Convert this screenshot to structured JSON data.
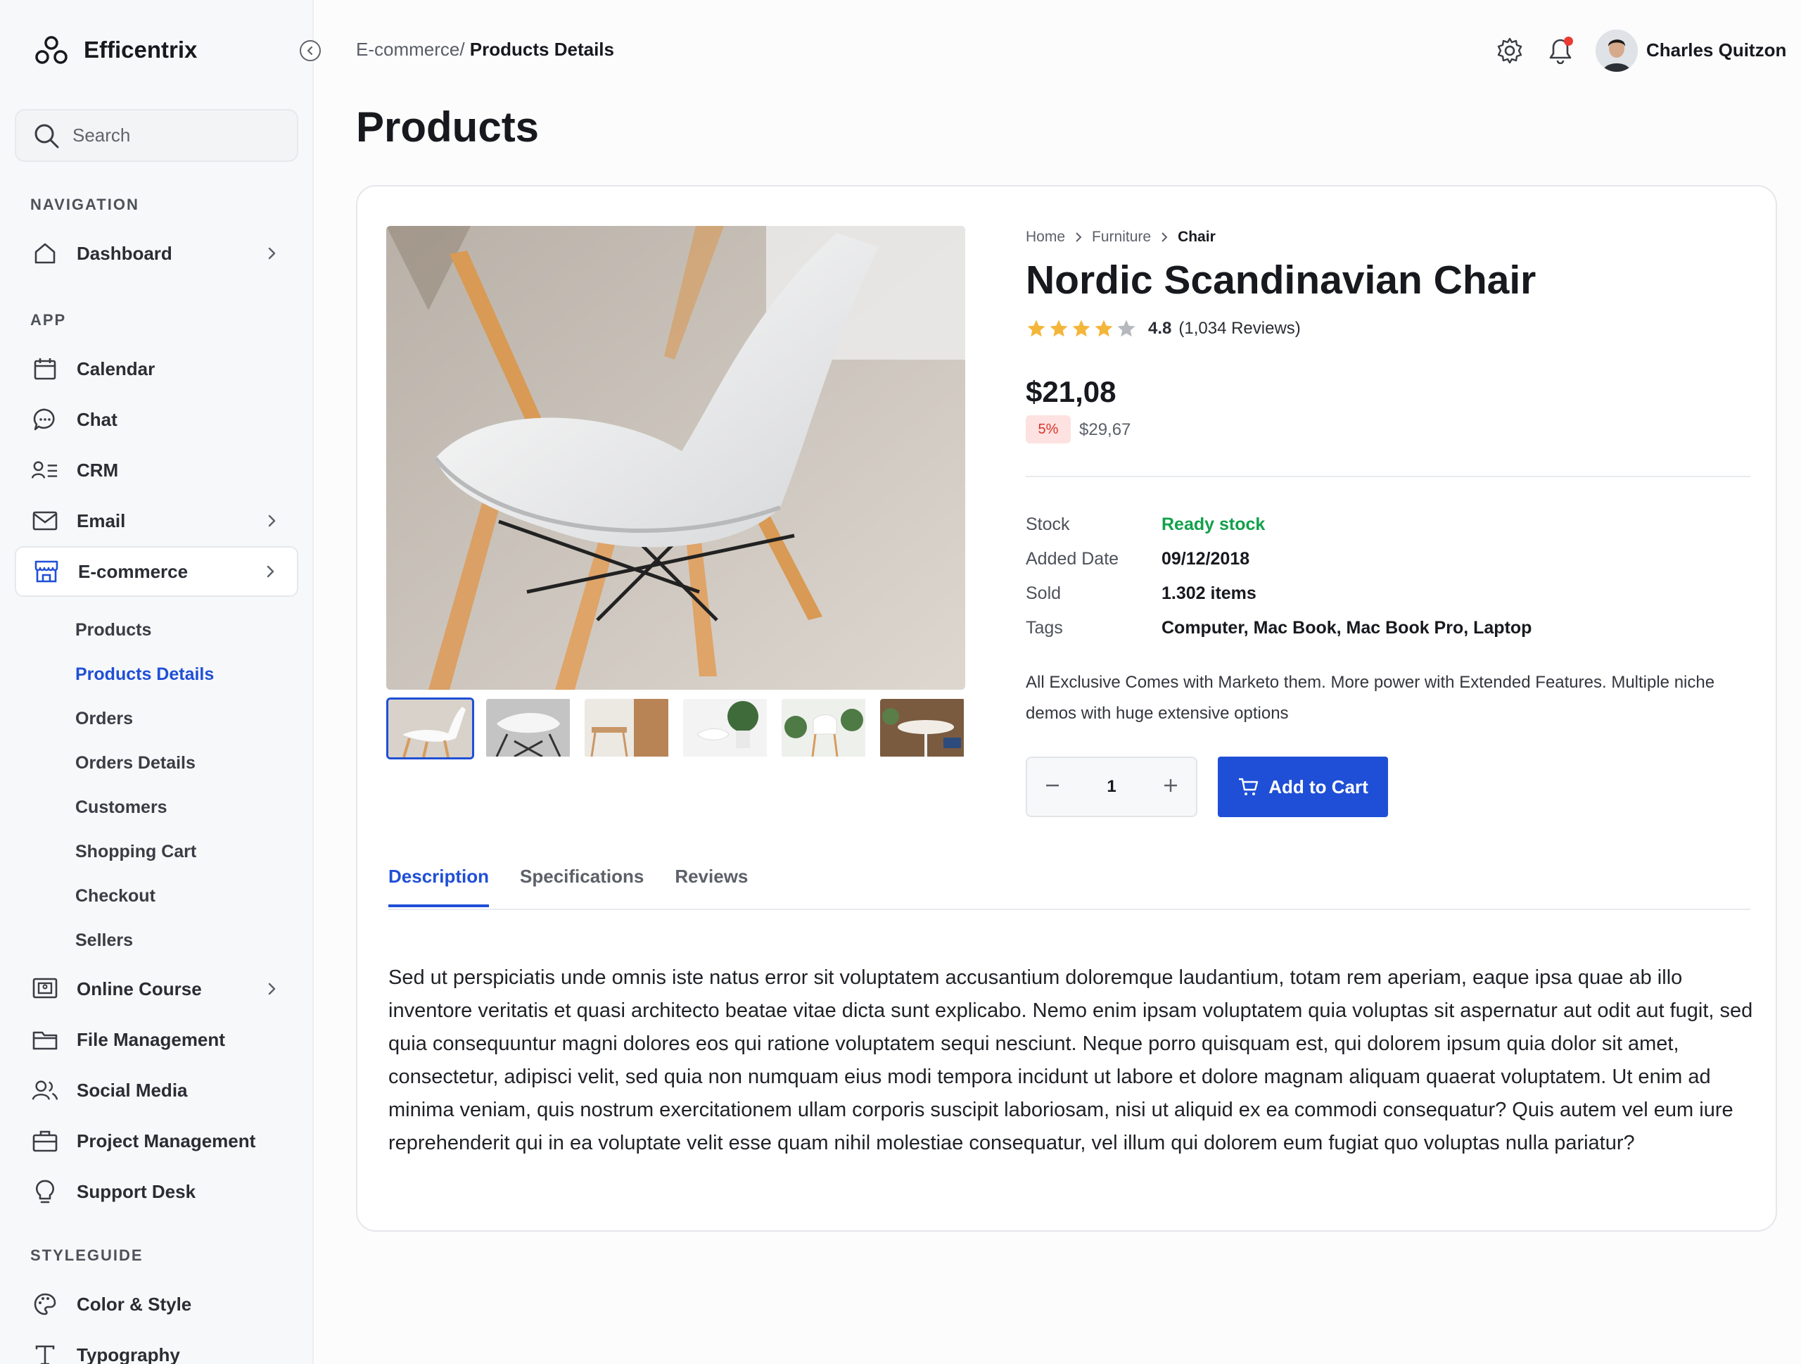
{
  "brand": {
    "name": "Efficentrix"
  },
  "search": {
    "placeholder": "Search"
  },
  "sidebar": {
    "sections": {
      "navigation": "NAVIGATION",
      "app": "APP",
      "styleguide": "STYLEGUIDE"
    },
    "items": {
      "dashboard": "Dashboard",
      "calendar": "Calendar",
      "chat": "Chat",
      "crm": "CRM",
      "email": "Email",
      "ecommerce": "E-commerce",
      "online_course": "Online Course",
      "file_management": "File Management",
      "social_media": "Social Media",
      "project_management": "Project Management",
      "support_desk": "Support Desk",
      "color_style": "Color & Style",
      "typography": "Typography"
    },
    "ecommerce_sub": [
      "Products",
      "Products Details",
      "Orders",
      "Orders Details",
      "Customers",
      "Shopping Cart",
      "Checkout",
      "Sellers"
    ],
    "active_sub": "Products Details"
  },
  "header": {
    "breadcrumb_parent": "E-commerce/",
    "breadcrumb_current": " Products Details",
    "user_name": "Charles Quitzon",
    "accent": "#1f4fd6",
    "notification_dot_color": "#ea3b32"
  },
  "page": {
    "title": "Products"
  },
  "product": {
    "crumbs": [
      "Home",
      "Furniture",
      "Chair"
    ],
    "title": "Nordic Scandinavian Chair",
    "rating_stars": 4,
    "rating_max": 5,
    "rating_value": "4.8",
    "rating_count": "(1,034 Reviews)",
    "price": "$21,08",
    "discount": "5%",
    "old_price": "$29,67",
    "info": {
      "stock_label": "Stock",
      "stock_value": "Ready stock",
      "date_label": "Added Date",
      "date_value": "09/12/2018",
      "sold_label": "Sold",
      "sold_value": "1.302 items",
      "tags_label": "Tags",
      "tags_value": "Computer, Mac Book, Mac Book Pro, Laptop"
    },
    "short_description": "All Exclusive Comes with Marketo them. More power with Extended Features. Multiple niche demos with huge extensive options",
    "quantity": "1",
    "add_to_cart": "Add to Cart"
  },
  "tabs": [
    "Description",
    "Specifications",
    "Reviews"
  ],
  "active_tab": "Description",
  "description": "Sed ut perspiciatis unde omnis iste natus error sit voluptatem accusantium doloremque laudantium, totam rem aperiam, eaque ipsa quae ab illo inventore veritatis et quasi architecto beatae vitae dicta sunt explicabo. Nemo enim ipsam voluptatem quia voluptas sit aspernatur aut odit aut fugit, sed quia consequuntur magni dolores eos qui ratione voluptatem sequi nesciunt. Neque porro quisquam est, qui dolorem ipsum quia dolor sit amet, consectetur, adipisci velit, sed quia non numquam eius modi tempora incidunt ut labore et dolore magnam aliquam quaerat voluptatem. Ut enim ad minima veniam, quis nostrum exercitationem ullam corporis suscipit laboriosam, nisi ut aliquid ex ea commodi consequatur? Quis autem vel eum iure reprehenderit qui in ea voluptate velit esse quam nihil molestiae consequatur, vel illum qui dolorem eum fugiat quo voluptas nulla pariatur?"
}
